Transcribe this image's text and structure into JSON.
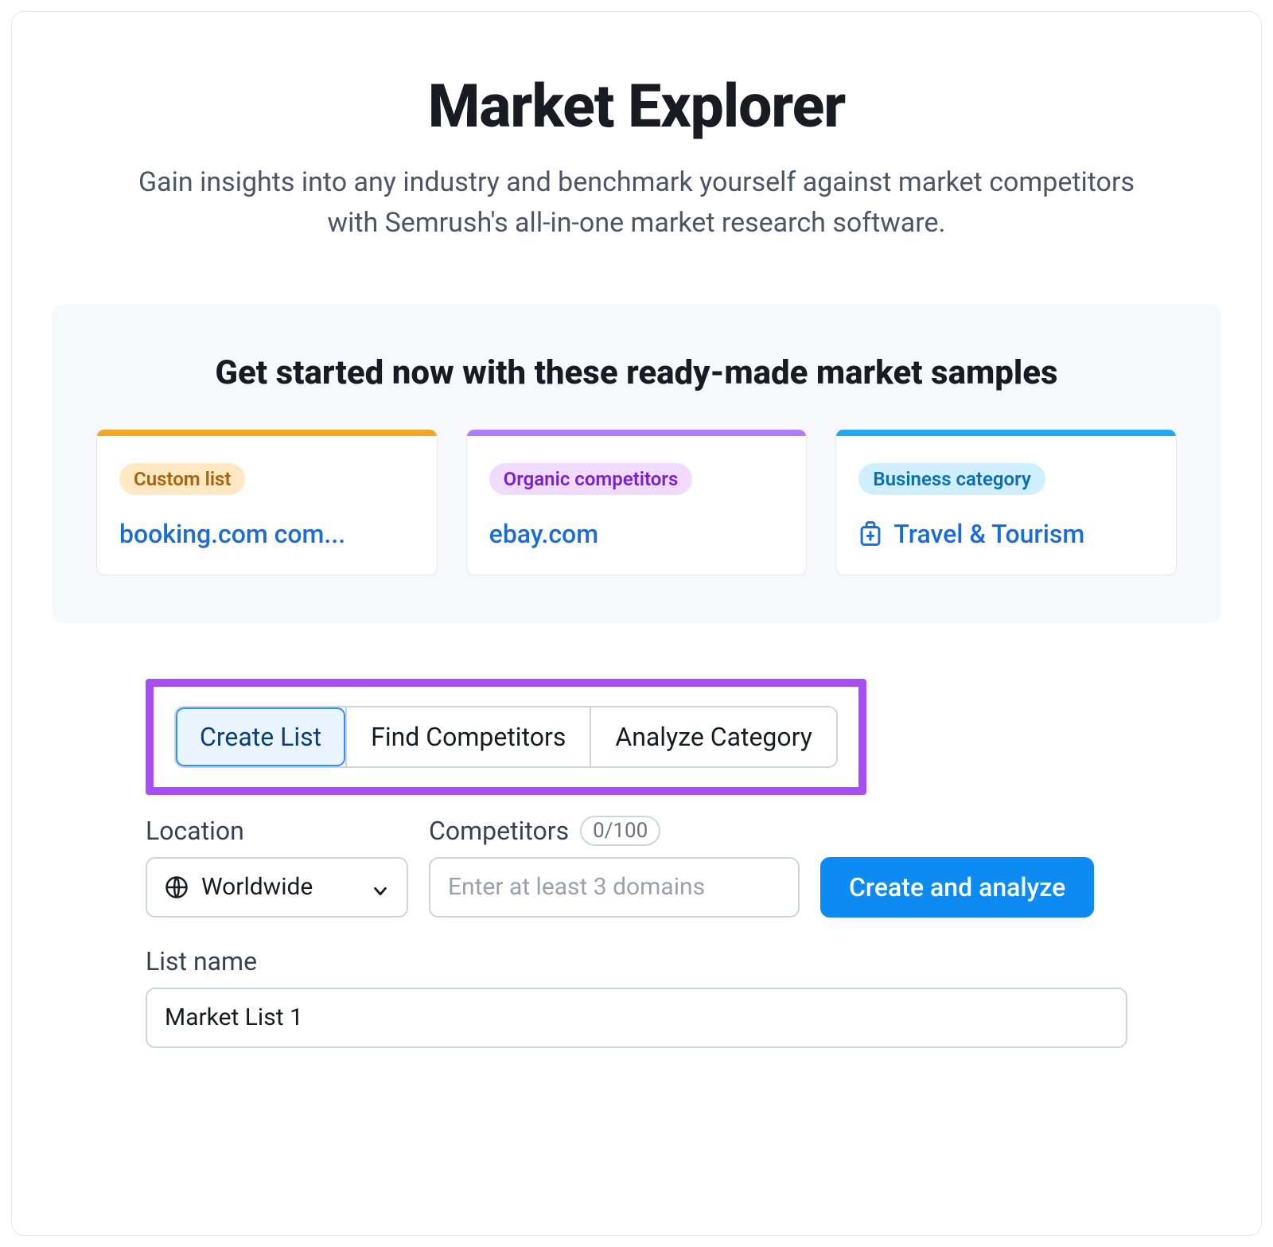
{
  "hero": {
    "title": "Market Explorer",
    "subtitle": "Gain insights into any industry and benchmark yourself against market competitors with Semrush's all-in-one market research software."
  },
  "samples": {
    "heading": "Get started now with these ready-made market samples",
    "cards": [
      {
        "badge": "Custom list",
        "link_text": "booking.com com...",
        "accent": "orange"
      },
      {
        "badge": "Organic competitors",
        "link_text": "ebay.com",
        "accent": "purple"
      },
      {
        "badge": "Business category",
        "link_text": "Travel & Tourism",
        "icon": "suitcase",
        "accent": "blue"
      }
    ]
  },
  "tabs": {
    "items": [
      {
        "label": "Create List",
        "active": true
      },
      {
        "label": "Find Competitors",
        "active": false
      },
      {
        "label": "Analyze Category",
        "active": false
      }
    ]
  },
  "form": {
    "location_label": "Location",
    "location_value": "Worldwide",
    "competitors_label": "Competitors",
    "competitors_count": "0/100",
    "competitors_placeholder": "Enter at least 3 domains",
    "submit_label": "Create and analyze",
    "listname_label": "List name",
    "listname_value": "Market List 1"
  },
  "colors": {
    "highlight_border": "#a64ef4",
    "primary_button": "#0d8bf2"
  }
}
